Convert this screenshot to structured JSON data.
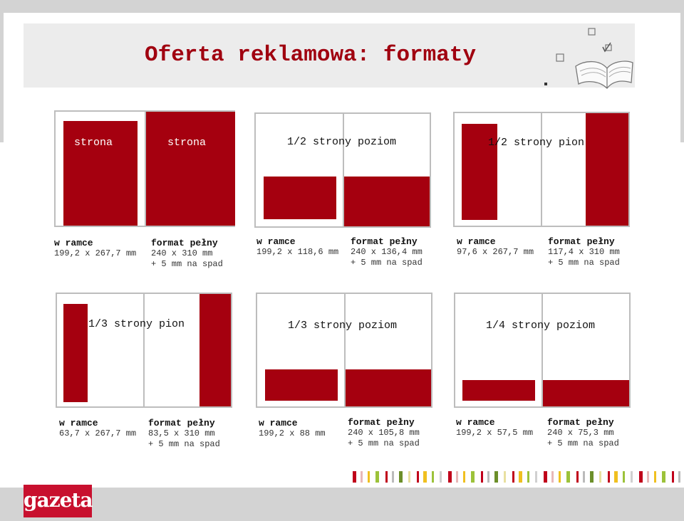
{
  "title": "Oferta reklamowa: formaty",
  "colors": {
    "accent": "#a5000f",
    "frame": "#bdbdbd",
    "background": "#d3d3d3"
  },
  "formats": [
    {
      "label": "strona",
      "label2": "strona",
      "frame": {
        "heading": "w ramce",
        "size": "199,2 x 267,7 mm"
      },
      "full": {
        "heading": "format pełny",
        "size": "240 x 310 mm",
        "bleed": "+ 5 mm na spad"
      }
    },
    {
      "label": "1/2 strony poziom",
      "frame": {
        "heading": "w ramce",
        "size": "199,2 x 118,6 mm"
      },
      "full": {
        "heading": "format pełny",
        "size": "240 x 136,4 mm",
        "bleed": "+ 5 mm na spad"
      }
    },
    {
      "label": "1/2 strony pion",
      "frame": {
        "heading": "w ramce",
        "size": "97,6 x 267,7 mm"
      },
      "full": {
        "heading": "format pełny",
        "size": "117,4 x 310 mm",
        "bleed": "+ 5 mm na spad"
      }
    },
    {
      "label": "1/3 strony pion",
      "frame": {
        "heading": "w ramce",
        "size": "63,7 x 267,7 mm"
      },
      "full": {
        "heading": "format pełny",
        "size": "83,5 x 310 mm",
        "bleed": "+ 5 mm na spad"
      }
    },
    {
      "label": "1/3 strony poziom",
      "frame": {
        "heading": "w ramce",
        "size": "199,2 x 88 mm"
      },
      "full": {
        "heading": "format pełny",
        "size": "240 x 105,8 mm",
        "bleed": "+ 5 mm na spad"
      }
    },
    {
      "label": "1/4 strony poziom",
      "frame": {
        "heading": "w ramce",
        "size": "199,2 x 57,5 mm"
      },
      "full": {
        "heading": "format pełny",
        "size": "240 x 75,3 mm",
        "bleed": "+ 5 mm na spad"
      }
    }
  ],
  "logo": {
    "text": "gazeta",
    "icon": "gazeta-logo"
  },
  "decoration": {
    "icon": "open-book-icon"
  }
}
